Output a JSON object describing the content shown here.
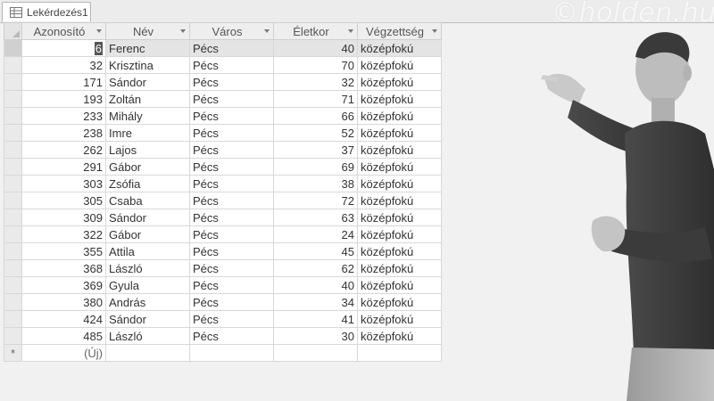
{
  "tab": {
    "title": "Lekérdezés1",
    "icon": "query-table-icon"
  },
  "columns": [
    "Azonosító",
    "Név",
    "Város",
    "Életkor",
    "Végzettség"
  ],
  "rows": [
    {
      "id": "6",
      "nev": "Ferenc",
      "varos": "Pécs",
      "eletkor": "40",
      "vegzettseg": "középfokú"
    },
    {
      "id": "32",
      "nev": "Krisztina",
      "varos": "Pécs",
      "eletkor": "70",
      "vegzettseg": "középfokú"
    },
    {
      "id": "171",
      "nev": "Sándor",
      "varos": "Pécs",
      "eletkor": "32",
      "vegzettseg": "középfokú"
    },
    {
      "id": "193",
      "nev": "Zoltán",
      "varos": "Pécs",
      "eletkor": "71",
      "vegzettseg": "középfokú"
    },
    {
      "id": "233",
      "nev": "Mihály",
      "varos": "Pécs",
      "eletkor": "66",
      "vegzettseg": "középfokú"
    },
    {
      "id": "238",
      "nev": "Imre",
      "varos": "Pécs",
      "eletkor": "52",
      "vegzettseg": "középfokú"
    },
    {
      "id": "262",
      "nev": "Lajos",
      "varos": "Pécs",
      "eletkor": "37",
      "vegzettseg": "középfokú"
    },
    {
      "id": "291",
      "nev": "Gábor",
      "varos": "Pécs",
      "eletkor": "69",
      "vegzettseg": "középfokú"
    },
    {
      "id": "303",
      "nev": "Zsófia",
      "varos": "Pécs",
      "eletkor": "38",
      "vegzettseg": "középfokú"
    },
    {
      "id": "305",
      "nev": "Csaba",
      "varos": "Pécs",
      "eletkor": "72",
      "vegzettseg": "középfokú"
    },
    {
      "id": "309",
      "nev": "Sándor",
      "varos": "Pécs",
      "eletkor": "63",
      "vegzettseg": "középfokú"
    },
    {
      "id": "322",
      "nev": "Gábor",
      "varos": "Pécs",
      "eletkor": "24",
      "vegzettseg": "középfokú"
    },
    {
      "id": "355",
      "nev": "Attila",
      "varos": "Pécs",
      "eletkor": "45",
      "vegzettseg": "középfokú"
    },
    {
      "id": "368",
      "nev": "László",
      "varos": "Pécs",
      "eletkor": "62",
      "vegzettseg": "középfokú"
    },
    {
      "id": "369",
      "nev": "Gyula",
      "varos": "Pécs",
      "eletkor": "40",
      "vegzettseg": "középfokú"
    },
    {
      "id": "380",
      "nev": "András",
      "varos": "Pécs",
      "eletkor": "34",
      "vegzettseg": "középfokú"
    },
    {
      "id": "424",
      "nev": "Sándor",
      "varos": "Pécs",
      "eletkor": "41",
      "vegzettseg": "középfokú"
    },
    {
      "id": "485",
      "nev": "László",
      "varos": "Pécs",
      "eletkor": "30",
      "vegzettseg": "középfokú"
    }
  ],
  "new_row": {
    "marker": "*",
    "placeholder": "(Új)"
  },
  "watermark": "©holden.hu",
  "colors": {
    "header_bg": "#eeeeee",
    "selected_row": "#e4e4e4",
    "grid_line": "#d8d8d8",
    "background": "#f1f1f1"
  }
}
